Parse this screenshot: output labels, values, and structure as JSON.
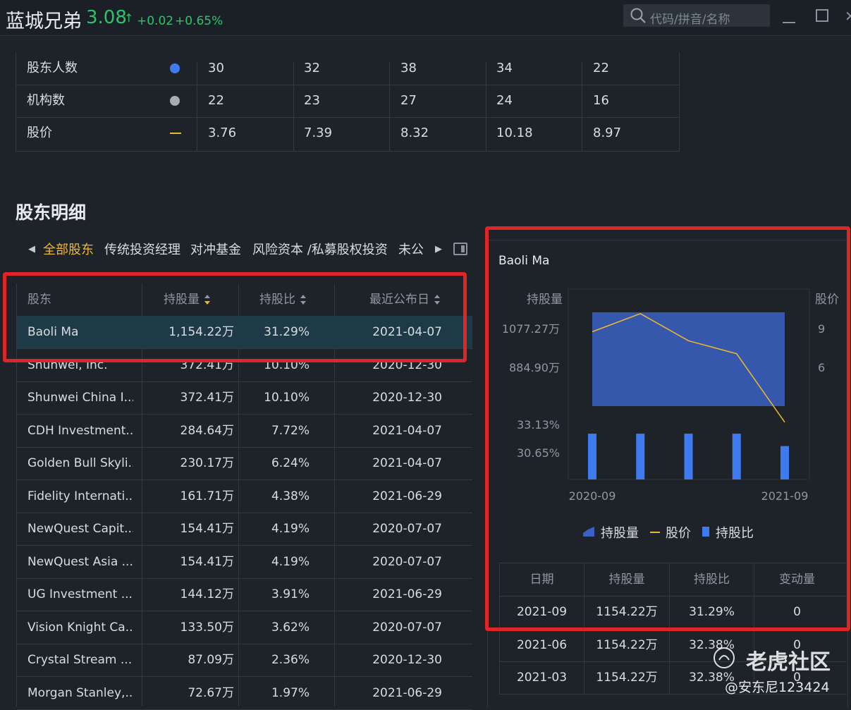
{
  "header": {
    "stock_name": "蓝城兄弟",
    "price": "3.08",
    "arrow": "↑",
    "change": "+0.02",
    "change_pct": "+0.65%",
    "search_placeholder": "代码/拼音/名称",
    "up_color": "#2cc46b"
  },
  "summary_table": {
    "rows": [
      {
        "label": "股东人数",
        "marker": "blue-dot",
        "values": [
          "30",
          "32",
          "38",
          "34",
          "22"
        ]
      },
      {
        "label": "机构数",
        "marker": "gray-dot",
        "values": [
          "22",
          "23",
          "27",
          "24",
          "16"
        ]
      },
      {
        "label": "股价",
        "marker": "yellow-line",
        "values": [
          "3.76",
          "7.39",
          "8.32",
          "10.18",
          "8.97"
        ]
      }
    ]
  },
  "section": {
    "title": "股东明细"
  },
  "tabs": {
    "items": [
      "全部股东",
      "传统投资经理",
      "对冲基金",
      "风险资本 /私募股权投资",
      "未公"
    ],
    "active": "全部股东"
  },
  "holders_table": {
    "headers": [
      "股东",
      "持股量",
      "持股比",
      "最近公布日"
    ],
    "rows": [
      [
        "Baoli Ma",
        "1,154.22万",
        "31.29%",
        "2021-04-07"
      ],
      [
        "Shunwei, Inc.",
        "372.41万",
        "10.10%",
        "2020-12-30"
      ],
      [
        "Shunwei China I...",
        "372.41万",
        "10.10%",
        "2020-12-30"
      ],
      [
        "CDH Investment...",
        "284.64万",
        "7.72%",
        "2021-04-07"
      ],
      [
        "Golden Bull Skyli...",
        "230.17万",
        "6.24%",
        "2021-04-07"
      ],
      [
        "Fidelity Internati...",
        "161.71万",
        "4.38%",
        "2021-06-29"
      ],
      [
        "NewQuest Capit...",
        "154.41万",
        "4.19%",
        "2020-07-07"
      ],
      [
        "NewQuest Asia ...",
        "154.41万",
        "4.19%",
        "2020-07-07"
      ],
      [
        "UG Investment ...",
        "144.12万",
        "3.91%",
        "2021-06-29"
      ],
      [
        "Vision Knight Ca...",
        "133.50万",
        "3.62%",
        "2020-07-07"
      ],
      [
        "Crystal Stream ...",
        "87.09万",
        "2.36%",
        "2020-12-30"
      ],
      [
        "Morgan Stanley,...",
        "72.67万",
        "1.97%",
        "2021-06-29"
      ]
    ]
  },
  "detail_panel": {
    "holder_name": "Baoli Ma",
    "legend": [
      "持股量",
      "股价",
      "持股比"
    ],
    "table": {
      "headers": [
        "日期",
        "持股量",
        "持股比",
        "变动量"
      ],
      "rows": [
        [
          "2021-09",
          "1154.22万",
          "31.29%",
          "0"
        ],
        [
          "2021-06",
          "1154.22万",
          "32.38%",
          "0"
        ],
        [
          "2021-03",
          "1154.22万",
          "32.38%",
          "0"
        ]
      ]
    }
  },
  "chart_data": {
    "type": "area",
    "left_axis_label": "持股量",
    "right_axis_label": "股价",
    "left_ticks": [
      "1077.27万",
      "884.90万"
    ],
    "right_ticks": [
      "9",
      "6"
    ],
    "pct_ticks": [
      "33.13%",
      "30.65%"
    ],
    "x_ticks": [
      "2020-09",
      "2021-09"
    ],
    "series": [
      {
        "name": "持股量",
        "kind": "area",
        "values": [
          1154.22,
          1154.22,
          1154.22,
          1154.22,
          1154.22
        ],
        "color": "#3a62c4"
      },
      {
        "name": "股价",
        "kind": "line",
        "values": [
          8.7,
          10.1,
          8.0,
          7.0,
          1.7
        ],
        "color": "#f0b82b"
      },
      {
        "name": "持股比",
        "kind": "bar",
        "values": [
          32.38,
          32.38,
          32.38,
          32.38,
          31.29
        ],
        "color": "#3f7bf0"
      }
    ]
  },
  "watermark": {
    "brand": "老虎社区",
    "user": "@安东尼123424"
  },
  "highlight_color": "#e02525"
}
